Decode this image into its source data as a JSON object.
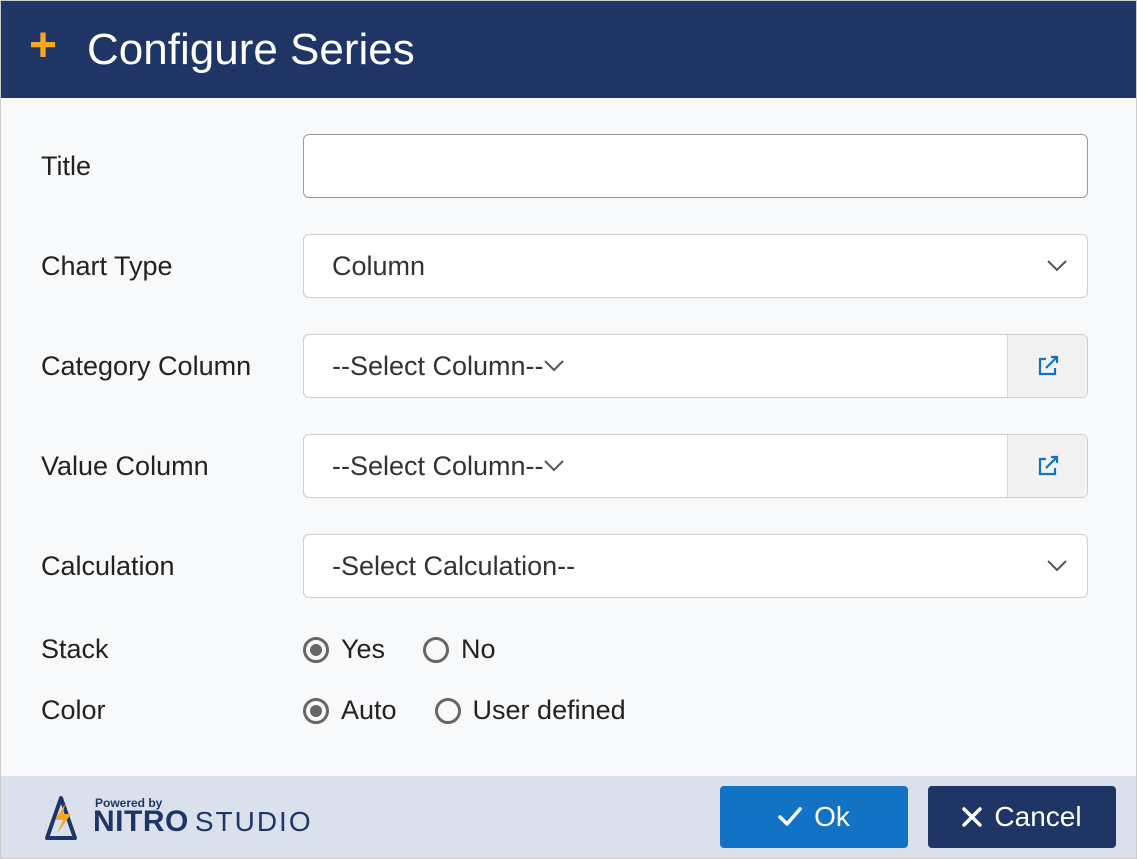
{
  "header": {
    "title": "Configure Series"
  },
  "form": {
    "title_label": "Title",
    "title_value": "",
    "chart_type_label": "Chart Type",
    "chart_type_value": "Column",
    "category_column_label": "Category Column",
    "category_column_value": "--Select Column--",
    "value_column_label": "Value Column",
    "value_column_value": "--Select Column--",
    "calculation_label": "Calculation",
    "calculation_value": "-Select Calculation--",
    "stack_label": "Stack",
    "stack_yes": "Yes",
    "stack_no": "No",
    "stack_selected": "yes",
    "color_label": "Color",
    "color_auto": "Auto",
    "color_user": "User defined",
    "color_selected": "auto"
  },
  "footer": {
    "powered": "Powered by",
    "brand_main": "NITRO",
    "brand_sub": "STUDIO",
    "ok": "Ok",
    "cancel": "Cancel"
  }
}
